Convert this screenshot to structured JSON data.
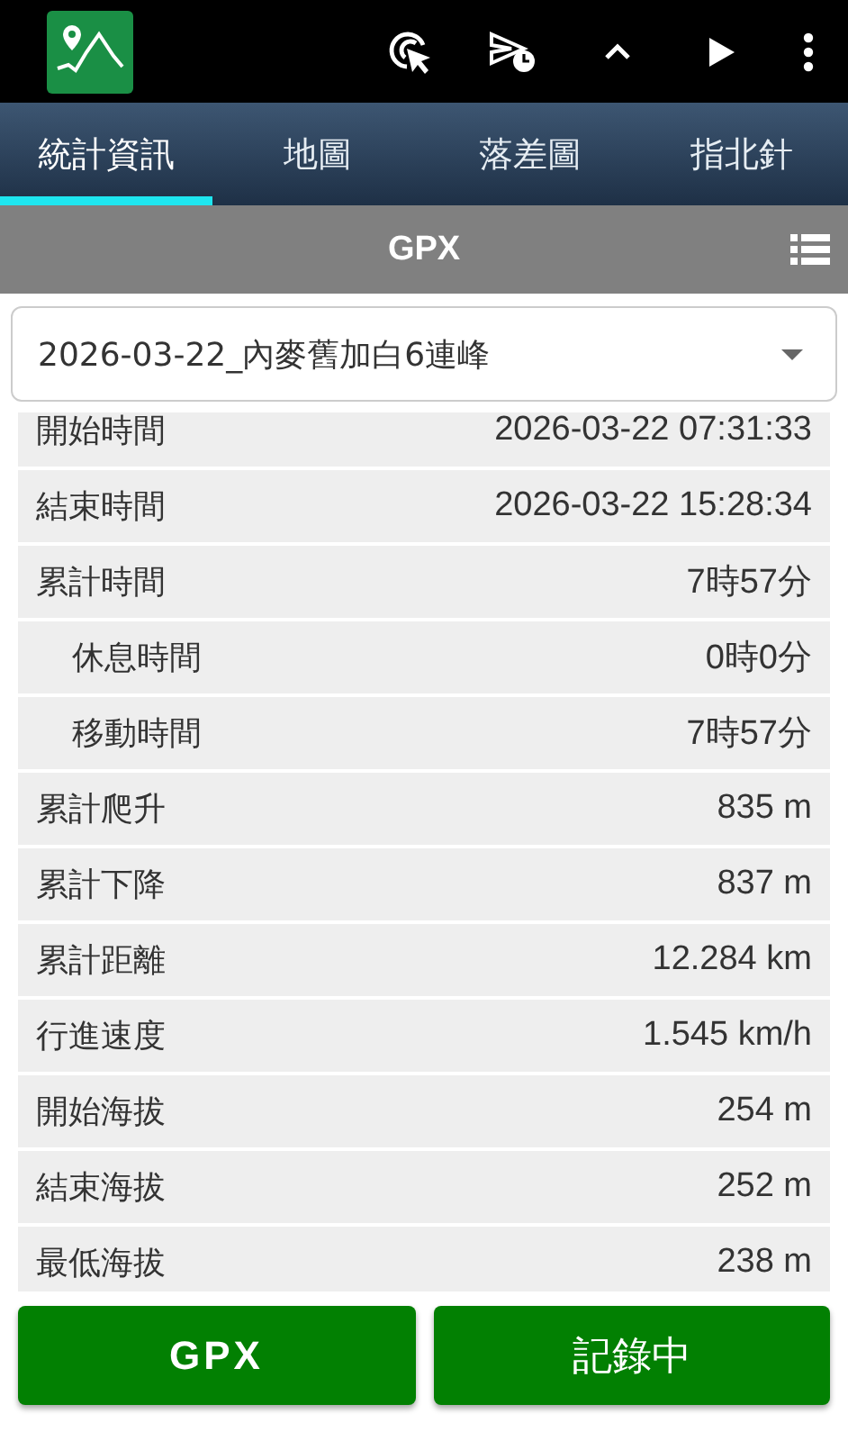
{
  "tabs": [
    {
      "label": "統計資訊",
      "selected": true
    },
    {
      "label": "地圖",
      "selected": false
    },
    {
      "label": "落差圖",
      "selected": false
    },
    {
      "label": "指北針",
      "selected": false
    }
  ],
  "header": {
    "title": "GPX"
  },
  "track_select": {
    "value": "2026-03-22_內麥舊加白6連峰"
  },
  "stats": [
    {
      "label": "開始時間",
      "value": "2026-03-22 07:31:33"
    },
    {
      "label": "結束時間",
      "value": "2026-03-22 15:28:34"
    },
    {
      "label": "累計時間",
      "value": "7時57分",
      "children": [
        {
          "label": "休息時間",
          "value": "0時0分"
        },
        {
          "label": "移動時間",
          "value": "7時57分"
        }
      ]
    },
    {
      "label": "累計爬升",
      "value": "835 m"
    },
    {
      "label": "累計下降",
      "value": "837 m"
    },
    {
      "label": "累計距離",
      "value": "12.284 km"
    },
    {
      "label": "行進速度",
      "value": "1.545 km/h"
    },
    {
      "label": "開始海拔",
      "value": "254 m"
    },
    {
      "label": "結束海拔",
      "value": "252 m"
    },
    {
      "label": "最低海拔",
      "value": "238 m"
    }
  ],
  "buttons": [
    {
      "label": "GPX",
      "kind": "gpx"
    },
    {
      "label": "記錄中",
      "kind": "record"
    }
  ]
}
